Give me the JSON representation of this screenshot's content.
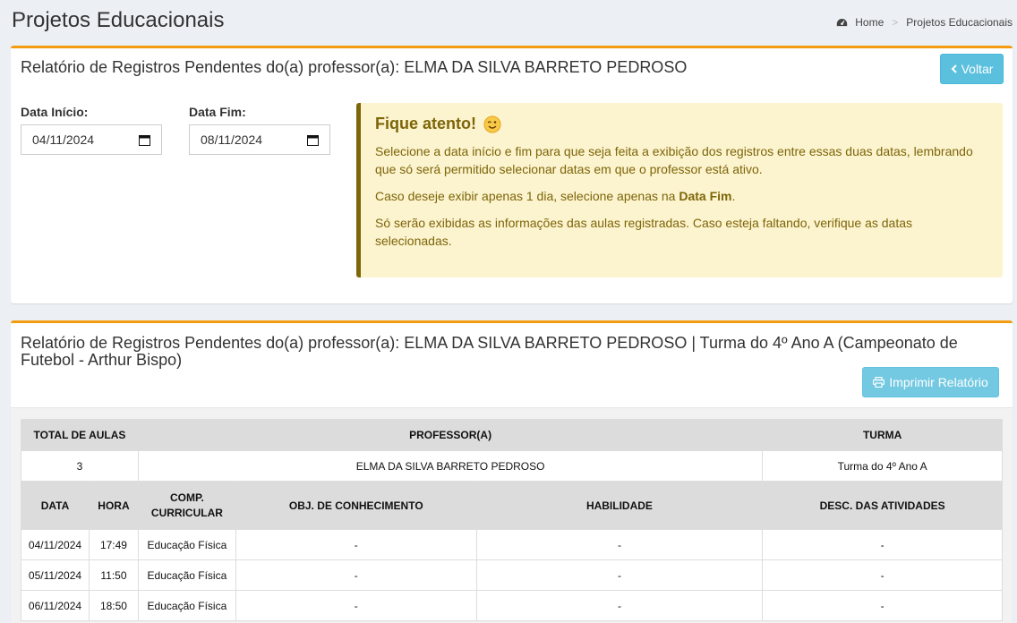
{
  "page": {
    "title": "Projetos Educacionais",
    "breadcrumb": [
      "Home",
      "Projetos Educacionais"
    ]
  },
  "filter_box": {
    "title": "Relatório de Registros Pendentes do(a) professor(a): ELMA DA SILVA BARRETO PEDROSO",
    "back_button": "Voltar",
    "start_label": "Data Início:",
    "start_value": "04/11/2024",
    "end_label": "Data Fim:",
    "end_value": "08/11/2024",
    "callout": {
      "title": "Fique atento!",
      "p1": "Selecione a data início e fim para que seja feita a exibição dos registros entre essas duas datas, lembrando que só será permitido selecionar datas em que o professor está ativo.",
      "p2_prefix": "Caso deseje exibir apenas 1 dia, selecione apenas na ",
      "p2_bold": "Data Fim",
      "p2_suffix": ".",
      "p3": "Só serão exibidas as informações das aulas registradas. Caso esteja faltando, verifique as datas selecionadas."
    }
  },
  "report_box": {
    "title": "Relatório de Registros Pendentes do(a) professor(a): ELMA DA SILVA BARRETO PEDROSO | Turma do 4º Ano A (Campeonato de Futebol - Arthur Bispo)",
    "print_button": "Imprimir Relatório",
    "summary_headers": [
      "TOTAL DE AULAS",
      "PROFESSOR(A)",
      "TURMA"
    ],
    "summary_values": [
      "3",
      "ELMA DA SILVA BARRETO PEDROSO",
      "Turma do 4º Ano A"
    ],
    "detail_headers": [
      "DATA",
      "HORA",
      "COMP. CURRICULAR",
      "OBJ. DE CONHECIMENTO",
      "HABILIDADE",
      "DESC. DAS ATIVIDADES"
    ],
    "rows": [
      [
        "04/11/2024",
        "17:49",
        "Educação Física",
        "-",
        "-",
        "-"
      ],
      [
        "05/11/2024",
        "11:50",
        "Educação Física",
        "-",
        "-",
        "-"
      ],
      [
        "06/11/2024",
        "18:50",
        "Educação Física",
        "-",
        "-",
        "-"
      ]
    ]
  },
  "colors": {
    "accent_border": "#f39c12",
    "info_button": "#5bc0de",
    "callout_bg": "#fcf3cf",
    "callout_text": "#7d6608"
  }
}
